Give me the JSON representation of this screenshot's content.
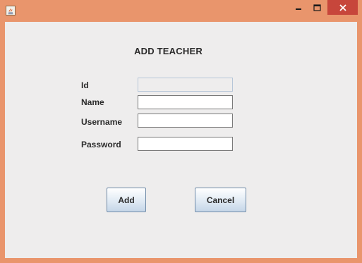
{
  "window": {
    "controls": [
      "minimize-icon",
      "maximize-icon",
      "close-icon"
    ],
    "frame_color": "#e9956c",
    "close_color": "#c7463b"
  },
  "form": {
    "heading": "ADD TEACHER",
    "fields": [
      {
        "label": "Id",
        "value": "",
        "enabled": false
      },
      {
        "label": "Name",
        "value": "",
        "enabled": true
      },
      {
        "label": "Username",
        "value": "",
        "enabled": true
      },
      {
        "label": "Password",
        "value": "",
        "enabled": true
      }
    ]
  },
  "buttons": {
    "add_label": "Add",
    "cancel_label": "Cancel"
  }
}
